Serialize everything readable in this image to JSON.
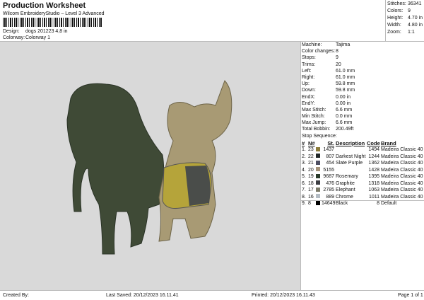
{
  "header": {
    "title": "Production Worksheet",
    "subtitle": "Wilcom EmbroideryStudio – Level 3 Advanced",
    "design_label": "Design:",
    "design": "dogs 201223 4,8 in",
    "colorway_label": "Colorway:",
    "colorway": "Colorway 1"
  },
  "stats": [
    {
      "label": "Stitches:",
      "value": "36341"
    },
    {
      "label": "Colors:",
      "value": "9"
    },
    {
      "label": "Height:",
      "value": "4.70 in"
    },
    {
      "label": "Width:",
      "value": "4.80 in"
    },
    {
      "label": "Zoom:",
      "value": "1:1"
    }
  ],
  "info": [
    {
      "label": "Machine:",
      "value": "Tajima"
    },
    {
      "label": "Color changes:",
      "value": "8"
    },
    {
      "label": "Stops:",
      "value": "9"
    },
    {
      "label": "Trims:",
      "value": "20"
    },
    {
      "label": "Left:",
      "value": "61.0 mm"
    },
    {
      "label": "Right:",
      "value": "61.0 mm"
    },
    {
      "label": "Up:",
      "value": "59.8 mm"
    },
    {
      "label": "Down:",
      "value": "59.8 mm"
    },
    {
      "label": "EndX:",
      "value": "0.00 in"
    },
    {
      "label": "EndY:",
      "value": "0.00 in"
    },
    {
      "label": "Max Stitch:",
      "value": "6.6 mm"
    },
    {
      "label": "Min Stitch:",
      "value": "0.0 mm"
    },
    {
      "label": "Max Jump:",
      "value": "6.6 mm"
    },
    {
      "label": "Total Bobbin:",
      "value": "200.49ft"
    }
  ],
  "stop_sequence_label": "Stop Sequence:",
  "columns": {
    "num": "#",
    "n": "N#",
    "st": "St.",
    "desc": "Description",
    "code": "Code",
    "brand": "Brand"
  },
  "stops": [
    {
      "num": "1.",
      "n": "23",
      "color": "#8c7c3c",
      "st": "1437",
      "desc": "",
      "code": "1494",
      "brand": "Madeira Classic 40"
    },
    {
      "num": "2.",
      "n": "22",
      "color": "#22292a",
      "st": "807",
      "desc": "Darkest Night",
      "code": "1244",
      "brand": "Madeira Classic 40"
    },
    {
      "num": "3.",
      "n": "21",
      "color": "#4e4f63",
      "st": "454",
      "desc": "Slate Purple",
      "code": "1362",
      "brand": "Madeira Classic 40"
    },
    {
      "num": "4.",
      "n": "20",
      "color": "#a5937a",
      "st": "5155",
      "desc": "",
      "code": "1428",
      "brand": "Madeira Classic 40"
    },
    {
      "num": "5.",
      "n": "19",
      "color": "#2a3b2a",
      "st": "9687",
      "desc": "Rosemary",
      "code": "1395",
      "brand": "Madeira Classic 40"
    },
    {
      "num": "6.",
      "n": "18",
      "color": "#3b3d42",
      "st": "476",
      "desc": "Graphite",
      "code": "1318",
      "brand": "Madeira Classic 40"
    },
    {
      "num": "7.",
      "n": "17",
      "color": "#7b7a68",
      "st": "2785",
      "desc": "Elephant",
      "code": "1063",
      "brand": "Madeira Classic 40"
    },
    {
      "num": "8.",
      "n": "16",
      "color": "#b4bcc4",
      "st": "889",
      "desc": "Chrome",
      "code": "1011",
      "brand": "Madeira Classic 40"
    },
    {
      "num": "9.",
      "n": "8",
      "color": "#000000",
      "st": "14649",
      "desc": "Black",
      "code": "8",
      "brand": "Default"
    }
  ],
  "footer": {
    "created": "Created By:",
    "saved": "Last Saved: 20/12/2023 16.11.41",
    "printed": "Printed: 20/12/2023 16.11.43",
    "page": "Page 1 of 1"
  }
}
